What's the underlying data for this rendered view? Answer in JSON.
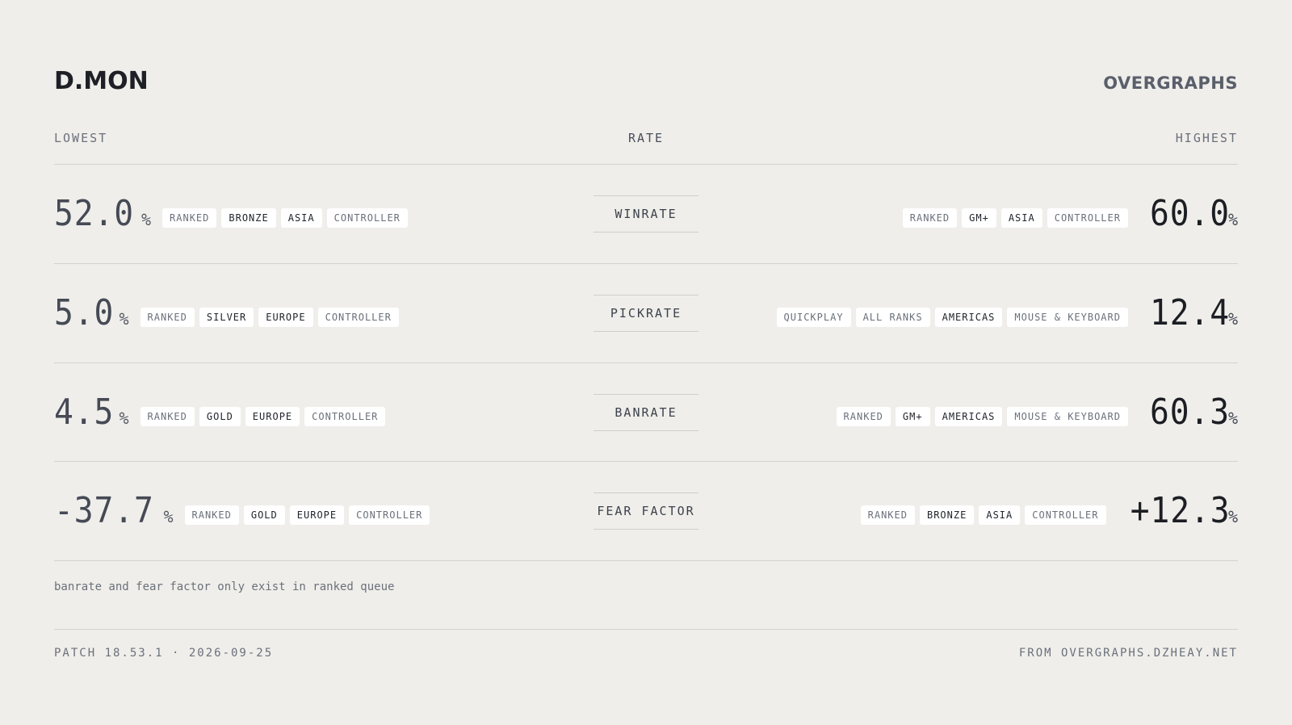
{
  "header": {
    "logo_left": "D.MON",
    "logo_right": "OVERGRAPHS"
  },
  "columns": {
    "lowest": "LOWEST",
    "rate": "RATE",
    "highest": "HIGHEST"
  },
  "rows": [
    {
      "metric": "WINRATE",
      "low": {
        "value": "52.0",
        "unit": "%",
        "tags": [
          "RANKED",
          "BRONZE",
          "ASIA",
          "CONTROLLER"
        ]
      },
      "high": {
        "value": "60.0",
        "unit": "%",
        "tags": [
          "RANKED",
          "GM+",
          "ASIA",
          "CONTROLLER"
        ]
      }
    },
    {
      "metric": "PICKRATE",
      "low": {
        "value": "5.0",
        "unit": "%",
        "tags": [
          "RANKED",
          "SILVER",
          "EUROPE",
          "CONTROLLER"
        ]
      },
      "high": {
        "value": "12.4",
        "unit": "%",
        "tags": [
          "QUICKPLAY",
          "ALL RANKS",
          "AMERICAS",
          "MOUSE & KEYBOARD"
        ]
      }
    },
    {
      "metric": "BANRATE",
      "low": {
        "value": "4.5",
        "unit": "%",
        "tags": [
          "RANKED",
          "GOLD",
          "EUROPE",
          "CONTROLLER"
        ]
      },
      "high": {
        "value": "60.3",
        "unit": "%",
        "tags": [
          "RANKED",
          "GM+",
          "AMERICAS",
          "MOUSE & KEYBOARD"
        ]
      }
    },
    {
      "metric": "FEAR FACTOR",
      "low": {
        "value": "-37.7",
        "unit": "%",
        "tags": [
          "RANKED",
          "GOLD",
          "EUROPE",
          "CONTROLLER"
        ]
      },
      "high": {
        "value": "+12.3",
        "unit": "%",
        "tags": [
          "RANKED",
          "BRONZE",
          "ASIA",
          "CONTROLLER"
        ]
      }
    }
  ],
  "note": "banrate and fear factor only exist in ranked queue",
  "footer": {
    "patch": "PATCH 18.53.1 · 2026-09-25",
    "source": "FROM OVERGRAPHS.DZHEAY.NET"
  },
  "colors": {
    "background": "#efeeea",
    "tag_background": "#ffffff",
    "text_dark": "#1c1e24",
    "text_muted": "#6b707b",
    "rule": "#d3d2cd"
  }
}
